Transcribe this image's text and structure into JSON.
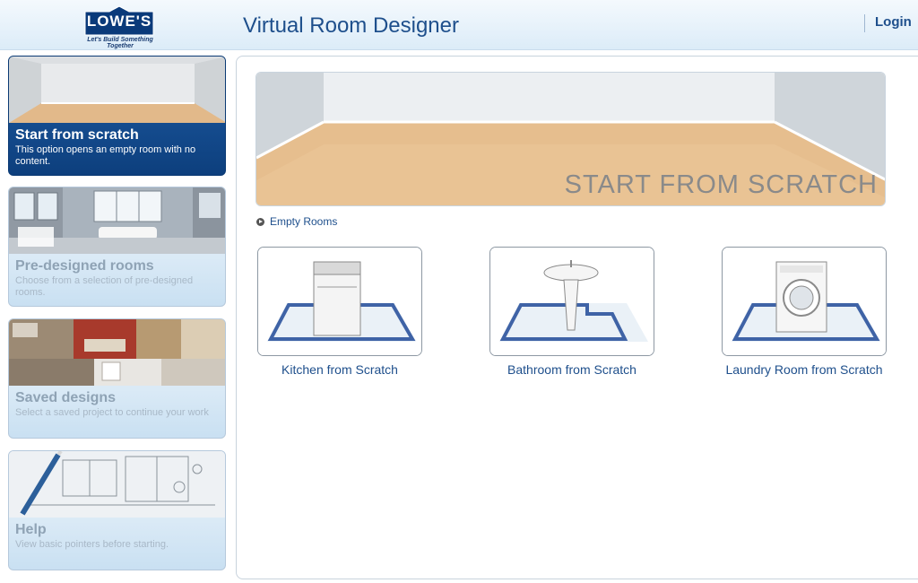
{
  "header": {
    "logo_text": "LOWE'S",
    "logo_tagline": "Let's Build Something Together",
    "app_title": "Virtual Room Designer",
    "login_label": "Login"
  },
  "sidebar": {
    "items": [
      {
        "title": "Start from scratch",
        "description": "This option opens an empty room with no content.",
        "active": true
      },
      {
        "title": "Pre-designed rooms",
        "description": "Choose from a selection of pre-designed rooms.",
        "active": false
      },
      {
        "title": "Saved designs",
        "description": "Select a saved project to continue your work",
        "active": false
      },
      {
        "title": "Help",
        "description": "View basic pointers before starting.",
        "active": false
      }
    ]
  },
  "main": {
    "hero_caption": "START FROM SCRATCH",
    "section_link": "Empty Rooms",
    "rooms": [
      {
        "label": "Kitchen from Scratch"
      },
      {
        "label": "Bathroom from Scratch"
      },
      {
        "label": "Laundry Room from Scratch"
      }
    ]
  },
  "colors": {
    "brand_blue": "#1e4f8c",
    "active_card": "#0d3f7d"
  }
}
